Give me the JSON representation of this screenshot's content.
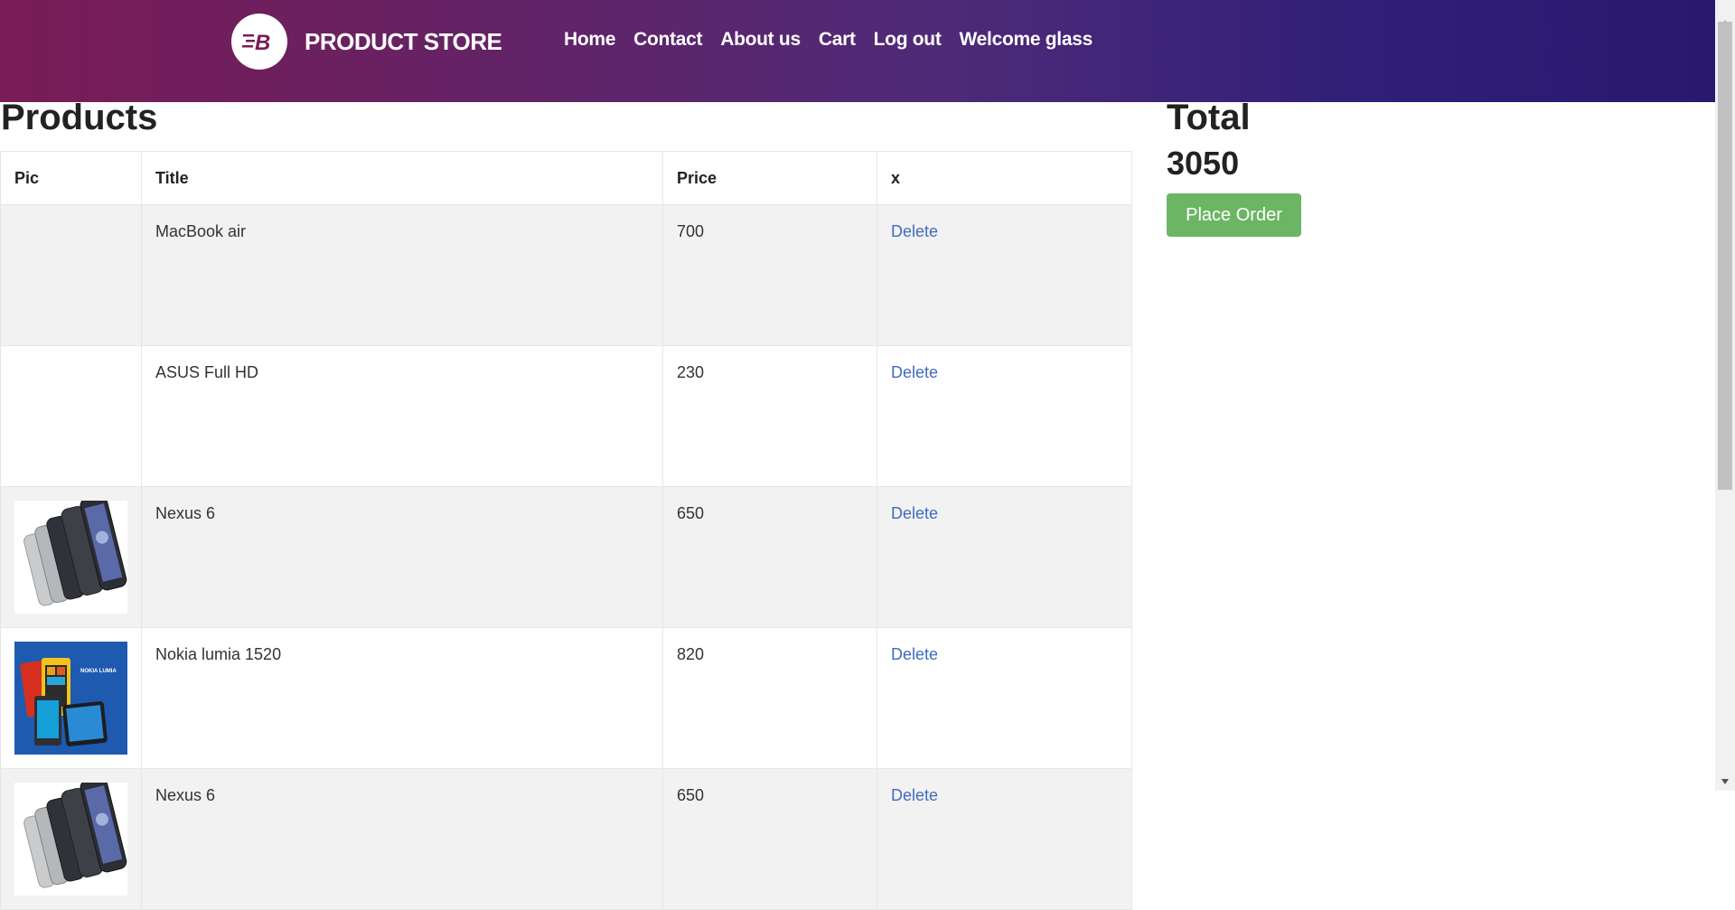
{
  "navbar": {
    "brand_name": "PRODUCT STORE",
    "links": [
      "Home",
      "Contact",
      "About us",
      "Cart",
      "Log out",
      "Welcome glass"
    ]
  },
  "products": {
    "heading": "Products",
    "columns": [
      "Pic",
      "Title",
      "Price",
      "x"
    ],
    "rows": [
      {
        "title": "MacBook air",
        "price": "700",
        "action": "Delete",
        "pic": "none"
      },
      {
        "title": "ASUS Full HD",
        "price": "230",
        "action": "Delete",
        "pic": "none"
      },
      {
        "title": "Nexus 6",
        "price": "650",
        "action": "Delete",
        "pic": "nexus-phones-image"
      },
      {
        "title": "Nokia lumia 1520",
        "price": "820",
        "action": "Delete",
        "pic": "nokia-lumia-image"
      },
      {
        "title": "Nexus 6",
        "price": "650",
        "action": "Delete",
        "pic": "nexus-phones-image"
      }
    ]
  },
  "total": {
    "heading": "Total",
    "value": "3050",
    "button_label": "Place Order"
  },
  "colors": {
    "navbar_start": "#7a1c57",
    "navbar_end": "#2a1870",
    "link": "#3f6cbd",
    "order_button": "#6cb565",
    "striped_row": "#f2f2f2"
  }
}
